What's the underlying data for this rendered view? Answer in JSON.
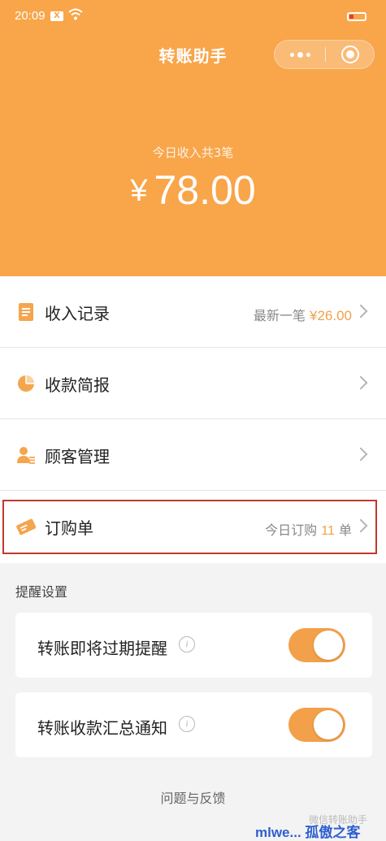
{
  "status_bar": {
    "time": "20:09",
    "notification_badge": "X"
  },
  "nav": {
    "title": "转账助手"
  },
  "summary": {
    "income_label": "今日收入共3笔",
    "currency": "¥",
    "amount": "78.00"
  },
  "menu": {
    "income_records": {
      "label": "收入记录",
      "right_prefix": "最新一笔",
      "right_currency": "¥",
      "right_amount": "26.00"
    },
    "payment_report": {
      "label": "收款简报"
    },
    "customer_management": {
      "label": "顾客管理"
    },
    "orders": {
      "label": "订购单",
      "right_prefix": "今日订购",
      "right_count": "11",
      "right_suffix": "单"
    }
  },
  "reminders": {
    "title": "提醒设置",
    "items": [
      {
        "label": "转账即将过期提醒",
        "enabled": true
      },
      {
        "label": "转账收款汇总通知",
        "enabled": true
      }
    ]
  },
  "footer": {
    "feedback": "问题与反馈",
    "watermark": "微信转账助手",
    "site_tag": "mlwe... 孤傲之客"
  },
  "colors": {
    "header": "#f9a54a",
    "accent": "#f0a24a",
    "toggle_on": "#f3a04a",
    "highlight_border": "#c0392b"
  }
}
